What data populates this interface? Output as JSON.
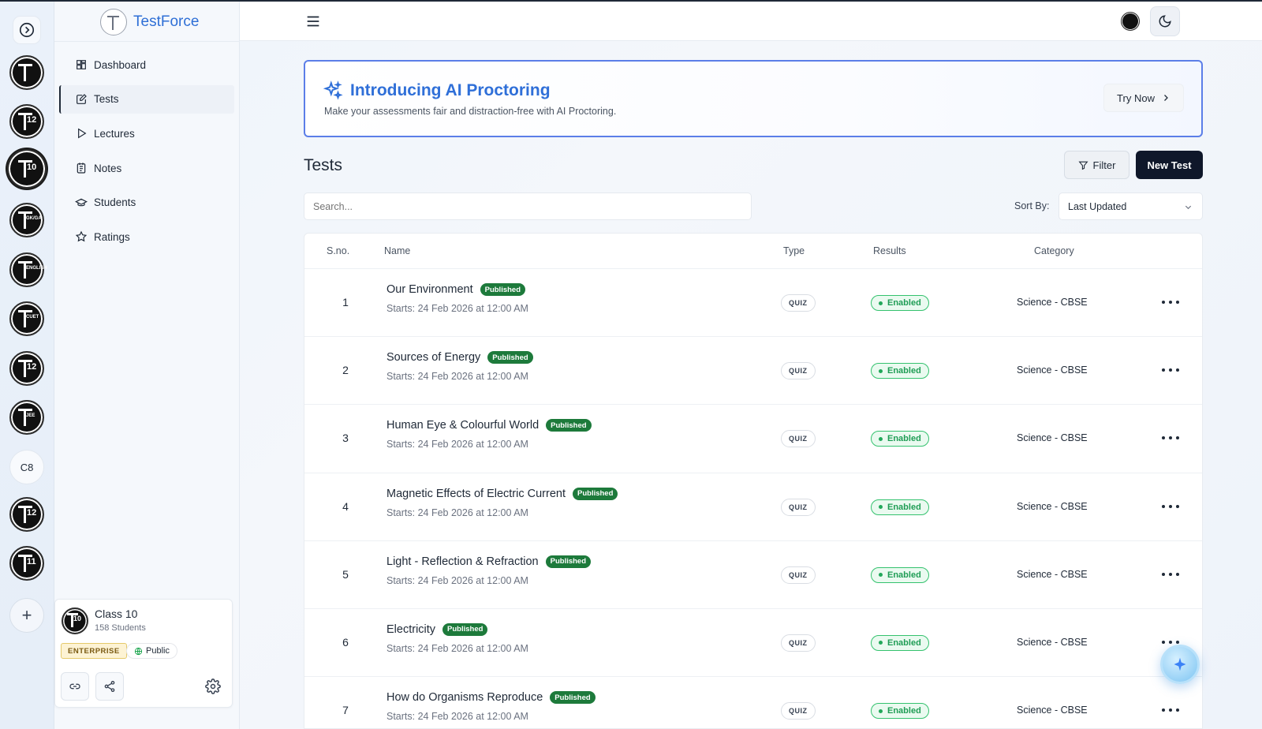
{
  "app": {
    "brand": "TestForce"
  },
  "rail": {
    "items": [
      {
        "num": "",
        "small": ""
      },
      {
        "num": "12",
        "small": ""
      },
      {
        "num": "10",
        "small": ""
      },
      {
        "num": "",
        "small": "GK/GA"
      },
      {
        "num": "",
        "small": "ENGLISH"
      },
      {
        "num": "",
        "small": "CUET"
      },
      {
        "num": "12",
        "small": ""
      },
      {
        "num": "",
        "small": "JEE"
      },
      {
        "text": "C8"
      },
      {
        "num": "12",
        "small": ""
      },
      {
        "num": "11",
        "small": ""
      }
    ],
    "add_label": "+"
  },
  "sidebar": {
    "nav": [
      {
        "label": "Dashboard",
        "icon": "dashboard-icon"
      },
      {
        "label": "Tests",
        "icon": "tests-icon"
      },
      {
        "label": "Lectures",
        "icon": "play-icon"
      },
      {
        "label": "Notes",
        "icon": "notes-icon"
      },
      {
        "label": "Students",
        "icon": "graduation-cap-icon"
      },
      {
        "label": "Ratings",
        "icon": "star-icon"
      }
    ],
    "class_card": {
      "name": "Class 10",
      "students": "158 Students",
      "plan": "ENTERPRISE",
      "visibility": "Public"
    }
  },
  "banner": {
    "title": "Introducing AI Proctoring",
    "subtitle": "Make your assessments fair and distraction-free with AI Proctoring.",
    "cta": "Try Now"
  },
  "tests": {
    "title": "Tests",
    "filter_label": "Filter",
    "new_label": "New Test",
    "search_placeholder": "Search...",
    "sort_label": "Sort By:",
    "sort_value": "Last Updated",
    "columns": [
      "S.no.",
      "Name",
      "Type",
      "Results",
      "Category"
    ],
    "rows": [
      {
        "sno": "1",
        "name": "Our Environment",
        "badge": "Published",
        "starts": "Starts: 24 Feb 2026 at 12:00 AM",
        "type": "QUIZ",
        "results": "Enabled",
        "category": "Science - CBSE"
      },
      {
        "sno": "2",
        "name": "Sources of Energy",
        "badge": "Published",
        "starts": "Starts: 24 Feb 2026 at 12:00 AM",
        "type": "QUIZ",
        "results": "Enabled",
        "category": "Science - CBSE"
      },
      {
        "sno": "3",
        "name": "Human Eye & Colourful World",
        "badge": "Published",
        "starts": "Starts: 24 Feb 2026 at 12:00 AM",
        "type": "QUIZ",
        "results": "Enabled",
        "category": "Science - CBSE"
      },
      {
        "sno": "4",
        "name": "Magnetic Effects of Electric Current",
        "badge": "Published",
        "starts": "Starts: 24 Feb 2026 at 12:00 AM",
        "type": "QUIZ",
        "results": "Enabled",
        "category": "Science - CBSE"
      },
      {
        "sno": "5",
        "name": "Light - Reflection & Refraction",
        "badge": "Published",
        "starts": "Starts: 24 Feb 2026 at 12:00 AM",
        "type": "QUIZ",
        "results": "Enabled",
        "category": "Science - CBSE"
      },
      {
        "sno": "6",
        "name": "Electricity",
        "badge": "Published",
        "starts": "Starts: 24 Feb 2026 at 12:00 AM",
        "type": "QUIZ",
        "results": "Enabled",
        "category": "Science - CBSE"
      },
      {
        "sno": "7",
        "name": "How do Organisms Reproduce",
        "badge": "Published",
        "starts": "Starts: 24 Feb 2026 at 12:00 AM",
        "type": "QUIZ",
        "results": "Enabled",
        "category": "Science - CBSE"
      }
    ]
  },
  "colors": {
    "brand": "#2e6fd6",
    "published": "#1d7a3b",
    "enabled": "#1f9d55",
    "primary_button": "#0f172a",
    "banner_border": "#5b7ee8"
  }
}
